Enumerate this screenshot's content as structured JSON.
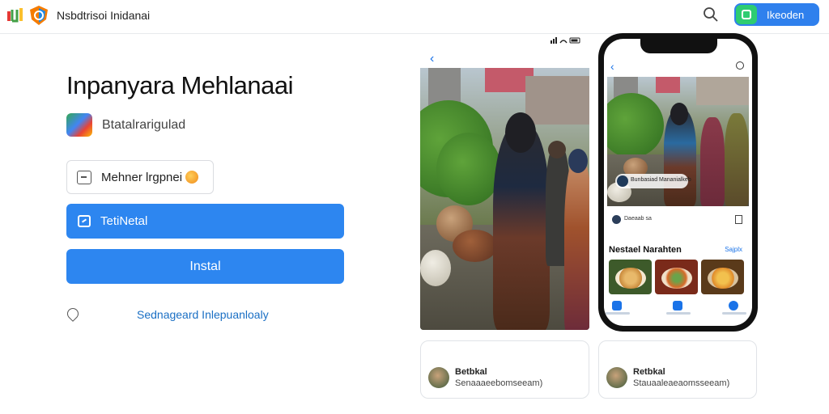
{
  "header": {
    "site_title": "Nsbdtrisoi Inidanai",
    "cta_label": "Ikeoden"
  },
  "app": {
    "title": "Inpanyara Mehlanaai",
    "developer": "Btatalrarigulad",
    "secondary_button": "Mehner lrgpnei",
    "primary_button": "TetiNetal",
    "install_button": "Instal",
    "info_link": "Sednageard Inlepuanloaly"
  },
  "phone": {
    "overlay_text": "Bunbasiad Mananialkeb",
    "row_text": "Daeaab sa",
    "section_title": "Nestael Narahten",
    "see_all": "Sajplx"
  },
  "cards": [
    {
      "name": "Betbkal",
      "subtitle": "Senaaaeebomseeam)"
    },
    {
      "name": "Retbkal",
      "subtitle": "Stauaaleaeaomsseeam)"
    }
  ],
  "carousel": {
    "card1_active_dot": 0,
    "card2_active_dot": 1
  },
  "colors": {
    "primary_blue": "#2d86f0",
    "cta_blue": "#2f80ed",
    "cta_icon_green": "#2ecc71",
    "link_blue": "#1a6fc4"
  }
}
